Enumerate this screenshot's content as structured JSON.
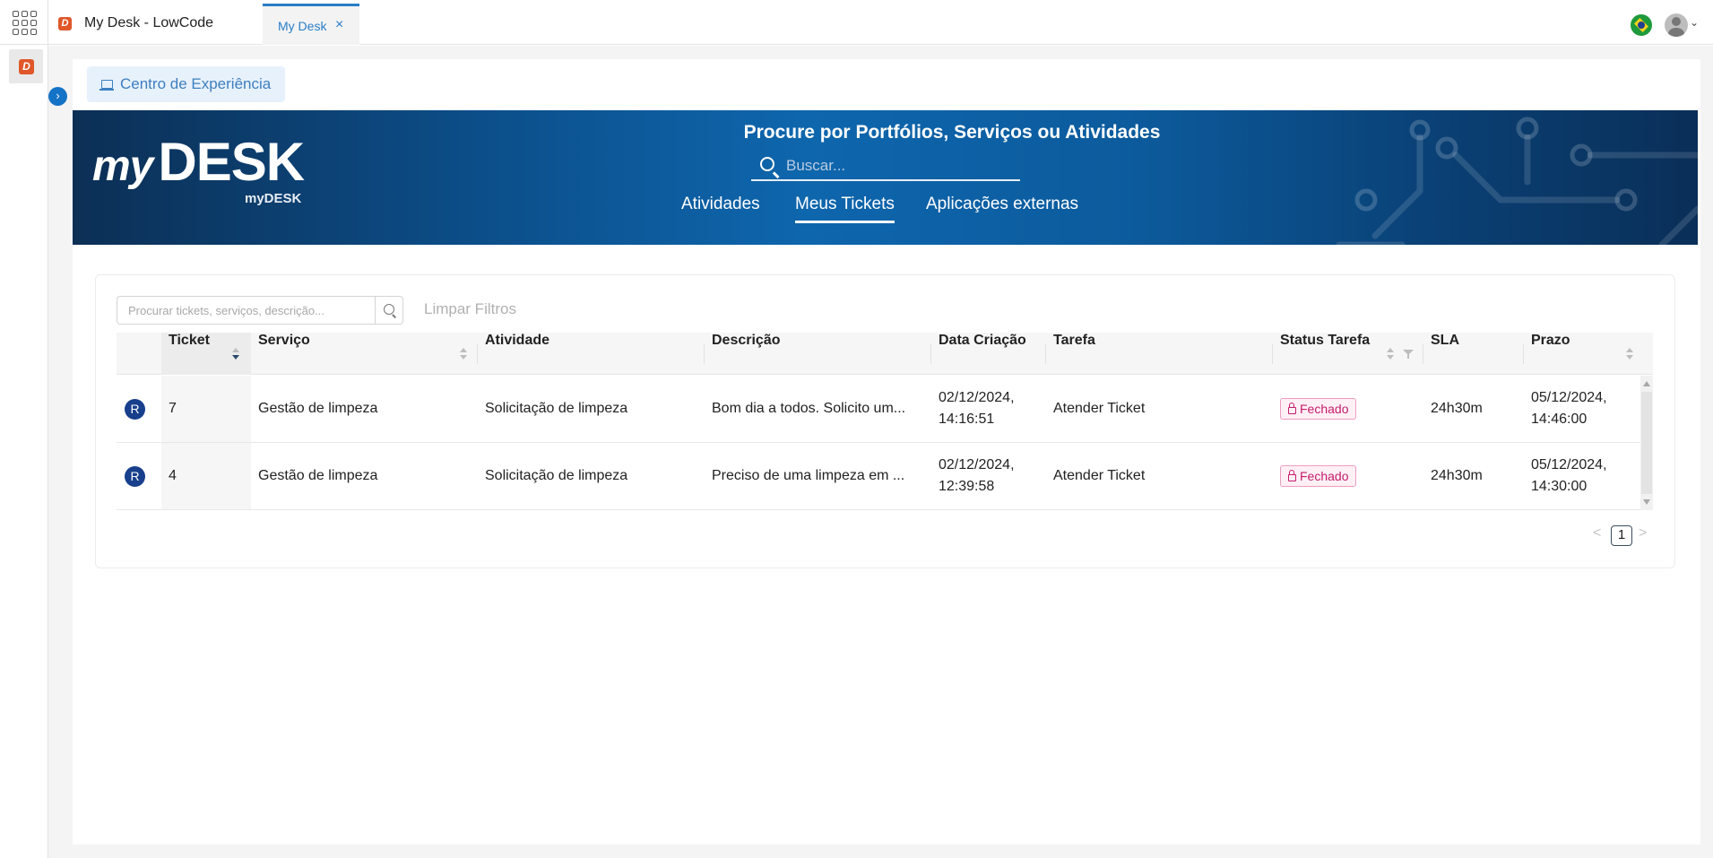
{
  "window": {
    "app_title": "My Desk - LowCode",
    "tab_label": "My Desk",
    "tab_close": "×",
    "avatar_chevron": "⌄",
    "icons": [
      "apps-grid-icon",
      "brazil-flag-icon",
      "user-avatar-icon",
      "chevron-down-icon",
      "close-icon"
    ]
  },
  "sidebar": {
    "item_label": "D",
    "expand_label": "›"
  },
  "breadcrumb": {
    "label": "Centro de Experiência",
    "icon": "monitor-icon"
  },
  "banner": {
    "brand_my": "my",
    "brand_desk": "DESK",
    "brand_sub": "myDESK",
    "title": "Procure por Portfólios, Serviços ou Atividades",
    "search_placeholder": "Buscar...",
    "tabs": [
      {
        "label": "Atividades",
        "active": false
      },
      {
        "label": "Meus Tickets",
        "active": true
      },
      {
        "label": "Aplicações externas",
        "active": false
      }
    ]
  },
  "table": {
    "search_placeholder": "Procurar tickets, serviços, descrição...",
    "clear_filters": "Limpar Filtros",
    "columns": [
      {
        "label": "Ticket",
        "sortable": true,
        "sort": "desc"
      },
      {
        "label": "Serviço",
        "sortable": true
      },
      {
        "label": "Atividade",
        "sortable": false
      },
      {
        "label": "Descrição",
        "sortable": false
      },
      {
        "label": "Data Criação",
        "sortable": false
      },
      {
        "label": "Tarefa",
        "sortable": false
      },
      {
        "label": "Status Tarefa",
        "sortable": true,
        "filterable": true
      },
      {
        "label": "SLA",
        "sortable": false
      },
      {
        "label": "Prazo",
        "sortable": true
      }
    ],
    "rows": [
      {
        "type_badge": "R",
        "ticket": "7",
        "servico": "Gestão de limpeza",
        "atividade": "Solicitação de limpeza",
        "descricao": "Bom dia a todos. Solicito um...",
        "data_criacao_date": "02/12/2024,",
        "data_criacao_time": "14:16:51",
        "tarefa": "Atender Ticket",
        "status": "Fechado",
        "sla": "24h30m",
        "prazo_date": "05/12/2024,",
        "prazo_time": "14:46:00"
      },
      {
        "type_badge": "R",
        "ticket": "4",
        "servico": "Gestão de limpeza",
        "atividade": "Solicitação de limpeza",
        "descricao": "Preciso de uma limpeza em ...",
        "data_criacao_date": "02/12/2024,",
        "data_criacao_time": "12:39:58",
        "tarefa": "Atender Ticket",
        "status": "Fechado",
        "sla": "24h30m",
        "prazo_date": "05/12/2024,",
        "prazo_time": "14:30:00"
      }
    ],
    "pagination": {
      "prev": "<",
      "current_page": "1",
      "next": ">"
    }
  },
  "colors": {
    "accent": "#1473c6",
    "brand_orange": "#e0572a",
    "status_closed": "#c41d6b",
    "badge_blue": "#173f8c"
  }
}
